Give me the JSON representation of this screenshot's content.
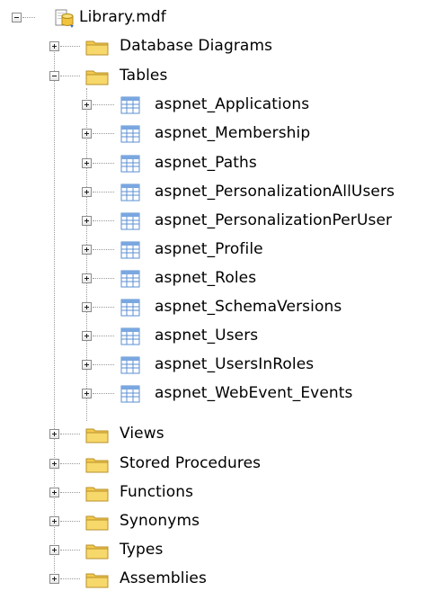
{
  "root": {
    "label": "Library.mdf",
    "icon": "database-file-icon",
    "expanded": true
  },
  "folders": [
    {
      "label": "Database Diagrams",
      "icon": "folder-icon",
      "expanded": false
    },
    {
      "label": "Tables",
      "icon": "folder-icon",
      "expanded": true
    },
    {
      "label": "Views",
      "icon": "folder-icon",
      "expanded": false
    },
    {
      "label": "Stored Procedures",
      "icon": "folder-icon",
      "expanded": false
    },
    {
      "label": "Functions",
      "icon": "folder-icon",
      "expanded": false
    },
    {
      "label": "Synonyms",
      "icon": "folder-icon",
      "expanded": false
    },
    {
      "label": "Types",
      "icon": "folder-icon",
      "expanded": false
    },
    {
      "label": "Assemblies",
      "icon": "folder-icon",
      "expanded": false
    }
  ],
  "tables": [
    {
      "label": "aspnet_Applications",
      "icon": "table-icon"
    },
    {
      "label": "aspnet_Membership",
      "icon": "table-icon"
    },
    {
      "label": "aspnet_Paths",
      "icon": "table-icon"
    },
    {
      "label": "aspnet_PersonalizationAllUsers",
      "icon": "table-icon"
    },
    {
      "label": "aspnet_PersonalizationPerUser",
      "icon": "table-icon"
    },
    {
      "label": "aspnet_Profile",
      "icon": "table-icon"
    },
    {
      "label": "aspnet_Roles",
      "icon": "table-icon"
    },
    {
      "label": "aspnet_SchemaVersions",
      "icon": "table-icon"
    },
    {
      "label": "aspnet_Users",
      "icon": "table-icon"
    },
    {
      "label": "aspnet_UsersInRoles",
      "icon": "table-icon"
    },
    {
      "label": "aspnet_WebEvent_Events",
      "icon": "table-icon"
    }
  ],
  "colors": {
    "folder": "#f2c94c",
    "table_grid": "#5b8fd0",
    "expander_border": "#8c8c8c",
    "tree_line": "#9a9a9a"
  }
}
